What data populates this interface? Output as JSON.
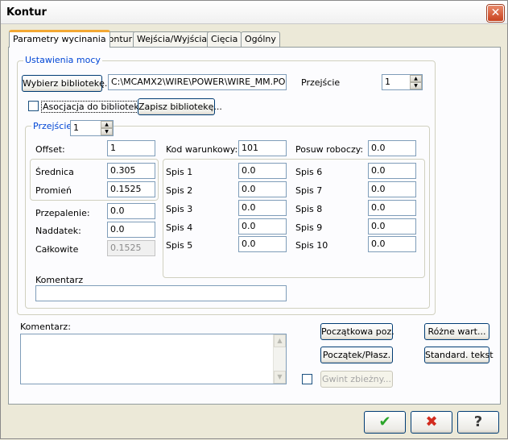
{
  "window": {
    "title": "Kontur",
    "close_glyph": "✕"
  },
  "tabs": [
    {
      "label": "Parametry wycinania",
      "active": true
    },
    {
      "label": "Kontur"
    },
    {
      "label": "Wejścia/Wyjścia"
    },
    {
      "label": "Cięcia"
    },
    {
      "label": "Ogólny"
    }
  ],
  "power": {
    "legend": "Ustawienia mocy",
    "choose_library_label": "Wybierz bibliotekę...",
    "library_path": "C:\\MCAMX2\\WIRE\\POWER\\WIRE_MM.PO",
    "pass_label": "Przejście",
    "pass_value": "1",
    "assoc_label": "Asocjacja do biblioteki",
    "save_library_label": "Zapisz bibliotekę..."
  },
  "pass": {
    "legend": "Przejście",
    "value": "1",
    "offset_label": "Offset:",
    "offset_value": "1",
    "code_label": "Kod warunkowy:",
    "code_value": "101",
    "feed_label": "Posuw roboczy:",
    "feed_value": "0.0",
    "diameter_label": "Średnica",
    "diameter_value": "0.305",
    "radius_label": "Promień",
    "radius_value": "0.1525",
    "burn_label": "Przepalenie:",
    "burn_value": "0.0",
    "allowance_label": "Naddatek:",
    "allowance_value": "0.0",
    "total_label": "Całkowite",
    "total_value": "0.1525",
    "spis": [
      {
        "label": "Spis 1",
        "value": "0.0"
      },
      {
        "label": "Spis 2",
        "value": "0.0"
      },
      {
        "label": "Spis 3",
        "value": "0.0"
      },
      {
        "label": "Spis 4",
        "value": "0.0"
      },
      {
        "label": "Spis 5",
        "value": "0.0"
      },
      {
        "label": "Spis 6",
        "value": "0.0"
      },
      {
        "label": "Spis 7",
        "value": "0.0"
      },
      {
        "label": "Spis 8",
        "value": "0.0"
      },
      {
        "label": "Spis 9",
        "value": "0.0"
      },
      {
        "label": "Spis 10",
        "value": "0.0"
      }
    ],
    "comment_label": "Komentarz",
    "comment_value": ""
  },
  "bottom": {
    "comment_label": "Komentarz:",
    "start_pos_label": "Początkowa poz.",
    "start_plane_label": "Początek/Płasz.",
    "misc_values_label": "Różne wart...",
    "standard_text_label": "Standard. tekst",
    "taper_thread_label": "Gwint zbieżny..."
  },
  "footer": {
    "ok_glyph": "✔",
    "cancel_glyph": "✖",
    "help_glyph": "?"
  },
  "colors": {
    "ok": "#2aa52a",
    "cancel": "#d22b1e",
    "help": "#3b3b3b",
    "legend": "#0046d5"
  }
}
